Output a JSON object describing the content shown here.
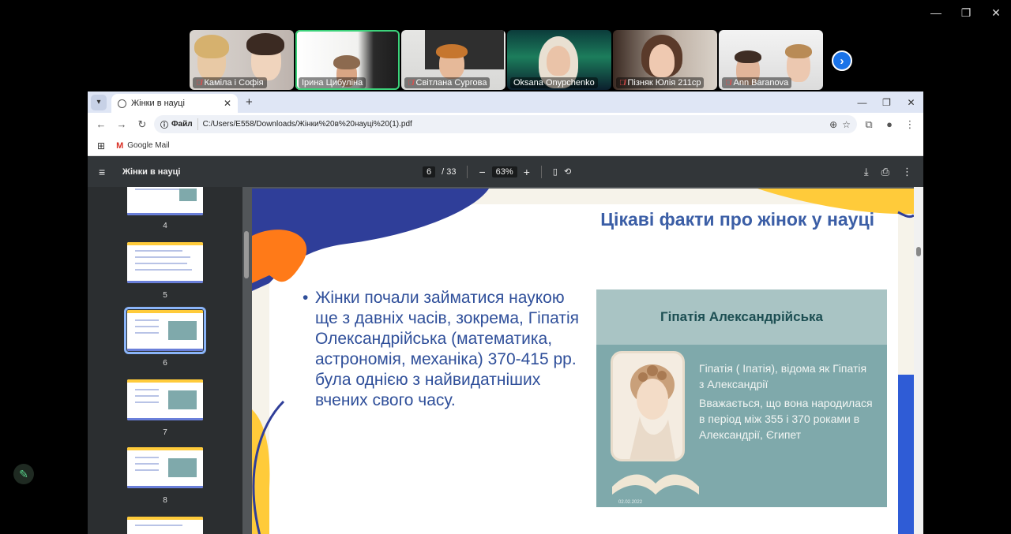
{
  "meeting": {
    "participants": [
      {
        "name": "Каміла і Софія",
        "muted": true
      },
      {
        "name": "Ірина Цибуліна",
        "muted": false
      },
      {
        "name": "Світлана Сургова",
        "muted": true
      },
      {
        "name": "Oksana Onypchenko",
        "muted": false
      },
      {
        "name": "Пізняк Юлія 211ср",
        "muted": true
      },
      {
        "name": "Ann Baranova",
        "muted": true
      }
    ]
  },
  "browser": {
    "tab_title": "Жінки в науці",
    "address_chip": "Файл",
    "url": "C:/Users/E558/Downloads/Жінки%20в%20науці%20(1).pdf",
    "bookmark_label": "Google Mail"
  },
  "pdf": {
    "title": "Жінки в науці",
    "current_page": "6",
    "total_pages": "/ 33",
    "zoom": "63%",
    "thumbnails": [
      "4",
      "5",
      "6",
      "7",
      "8"
    ]
  },
  "slide": {
    "title": "Цікаві факти про жінок у науці",
    "bullet": "Жінки почали займатися наукою ще з давніх часів, зокрема, Гіпатія Олександрійська (математика, астрономія, механіка) 370-415 рр. була однією з найвидатніших вчених свого часу.",
    "inner_title": "Гіпатія Александрійська",
    "inner_text_1": "Гіпатія ( Іпатія), відома як Гіпатія з Александрії",
    "inner_text_2": " Вважається, що вона народилася в період між 355 і 370 роками  в Александрії, Єгипет",
    "inner_footer": "02.02.2022"
  }
}
